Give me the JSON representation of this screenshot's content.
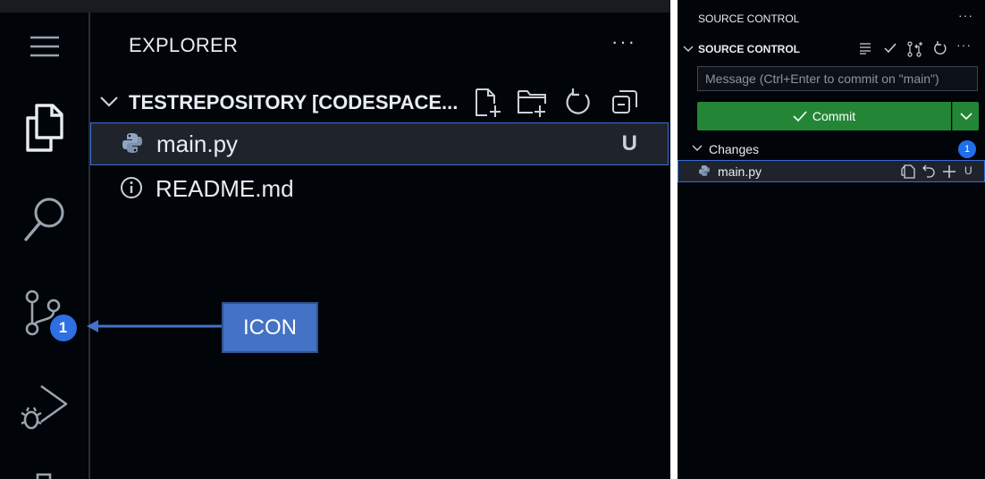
{
  "explorer": {
    "title": "EXPLORER",
    "more": "···",
    "repo_name": "TESTREPOSITORY [CODESPACE...",
    "files": [
      {
        "name": "main.py",
        "status": "U"
      },
      {
        "name": "README.md",
        "status": ""
      }
    ]
  },
  "activity_bar": {
    "source_control_badge": "1"
  },
  "callout": {
    "label": "ICON"
  },
  "source_control": {
    "header": "SOURCE CONTROL",
    "header_more": "···",
    "section_title": "SOURCE CONTROL",
    "section_more": "···",
    "message_placeholder": "Message (Ctrl+Enter to commit on \"main\")",
    "message_value": "",
    "commit_label": "Commit",
    "changes_label": "Changes",
    "changes_count": "1",
    "change_item": {
      "name": "main.py",
      "status": "U"
    }
  },
  "colors": {
    "background": "#010409",
    "commit_green": "#238636",
    "badge_blue": "#1f6feb",
    "callout_blue": "#4472c4"
  }
}
